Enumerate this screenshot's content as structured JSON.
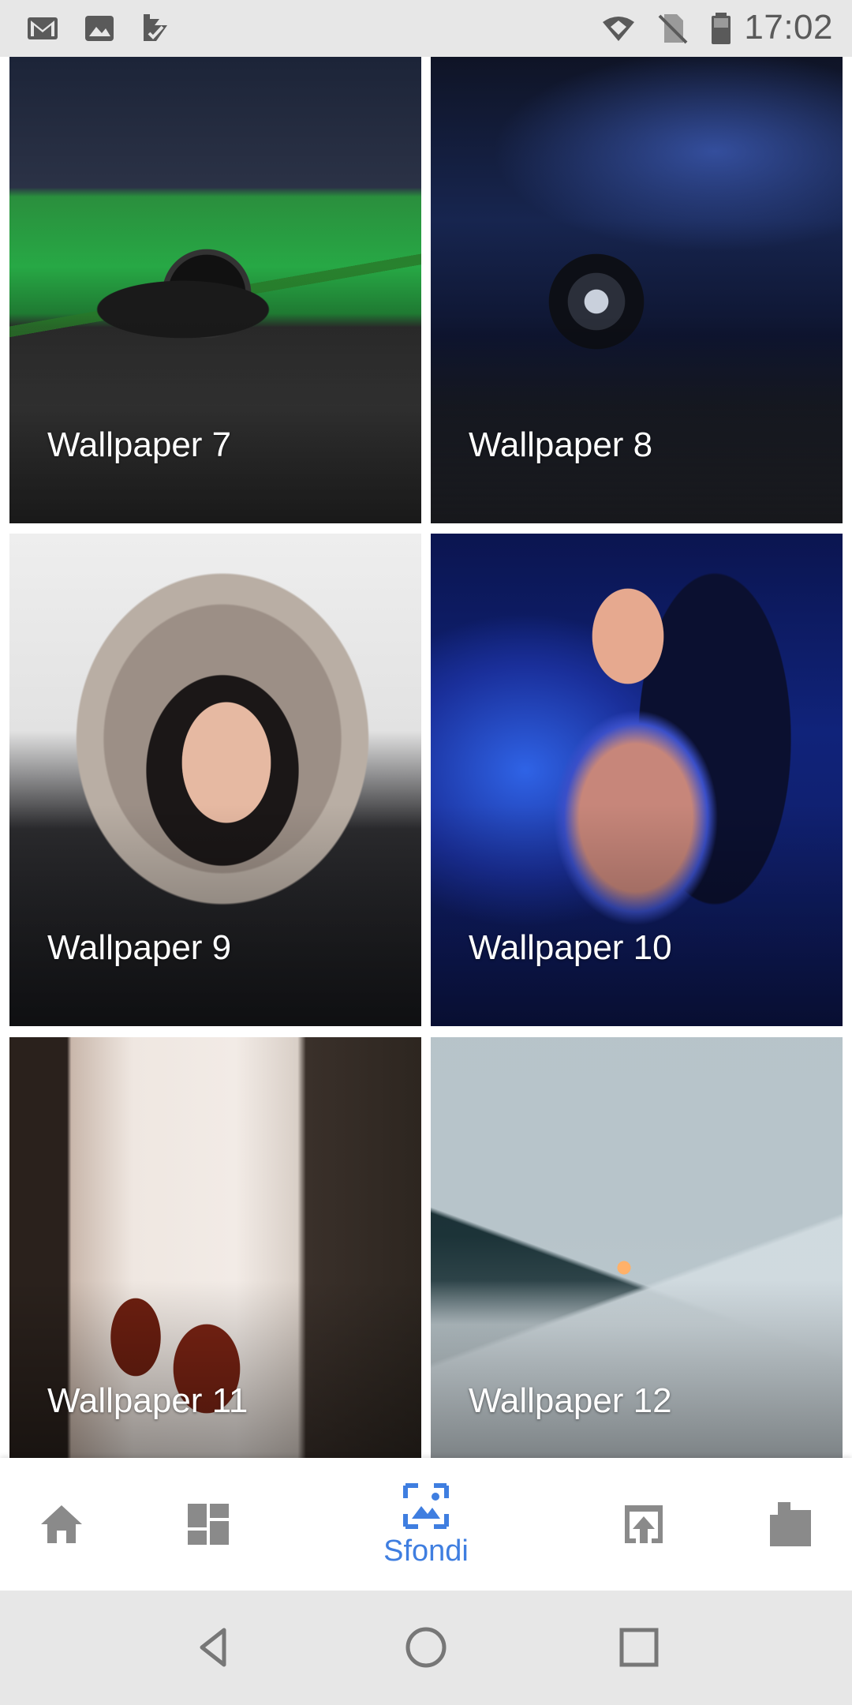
{
  "status_bar": {
    "time": "17:02",
    "left_icons": [
      "gmail-icon",
      "gallery-icon",
      "tasks-icon"
    ],
    "right_icons": [
      "wifi-icon",
      "no-sim-icon",
      "battery-icon"
    ]
  },
  "wallpapers": [
    {
      "label": "Wallpaper 7"
    },
    {
      "label": "Wallpaper 8"
    },
    {
      "label": "Wallpaper 9"
    },
    {
      "label": "Wallpaper 10"
    },
    {
      "label": "Wallpaper 11"
    },
    {
      "label": "Wallpaper 12"
    }
  ],
  "bottom_nav": {
    "items": [
      {
        "icon": "home-icon",
        "label": ""
      },
      {
        "icon": "dashboard-icon",
        "label": ""
      },
      {
        "icon": "wallpaper-icon",
        "label": "Sfondi",
        "active": true
      },
      {
        "icon": "upload-icon",
        "label": ""
      },
      {
        "icon": "package-icon",
        "label": ""
      }
    ],
    "active_color": "#3f7ee0",
    "inactive_color": "#8a8a8a"
  },
  "system_nav": [
    "back-icon",
    "home-circle-icon",
    "recents-icon"
  ]
}
